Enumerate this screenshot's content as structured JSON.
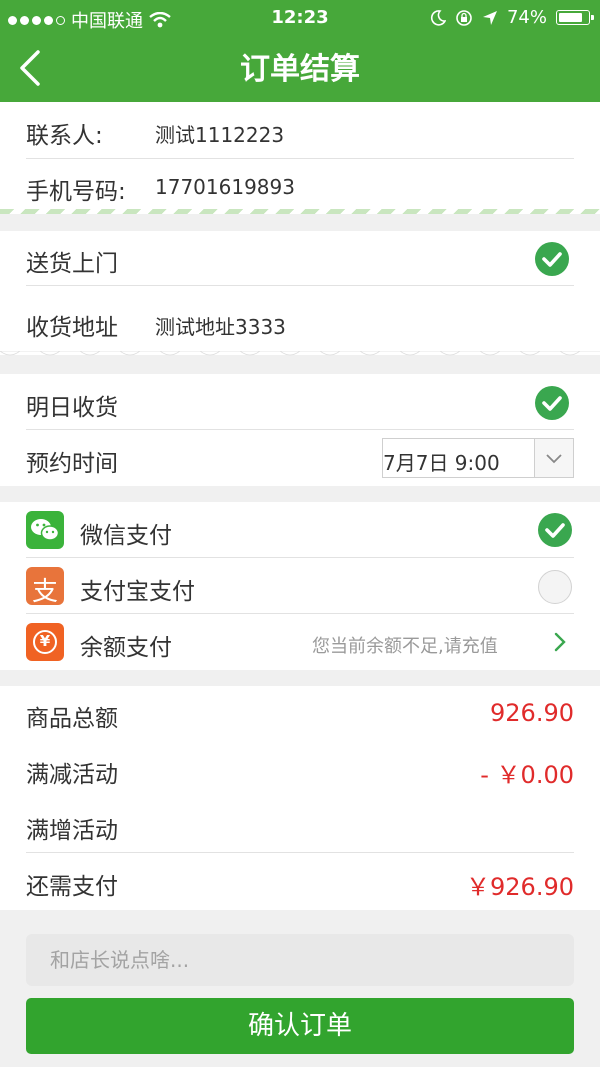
{
  "status_bar": {
    "carrier": "中国联通",
    "time": "12:23",
    "battery": "74%"
  },
  "nav": {
    "title": "订单结算"
  },
  "contact": {
    "name_label": "联系人:",
    "name_value": "测试1112223",
    "phone_label": "手机号码:",
    "phone_value": "17701619893"
  },
  "delivery": {
    "door_label": "送货上门",
    "address_label": "收货地址",
    "address_value": "测试地址3333"
  },
  "schedule": {
    "tomorrow_label": "明日收货",
    "time_label": "预约时间",
    "time_value": "7月7日 9:00"
  },
  "payment": {
    "wechat_label": "微信支付",
    "alipay_label": "支付宝支付",
    "alipay_glyph": "支",
    "balance_label": "余额支付",
    "balance_glyph": "¥",
    "balance_hint": "您当前余额不足,请充值"
  },
  "summary": {
    "total_label": "商品总额",
    "total_value": "926.90",
    "discount_label": "满减活动",
    "discount_value": "- ￥0.00",
    "gift_label": "满增活动",
    "due_label": "还需支付",
    "due_value": "￥926.90"
  },
  "note": {
    "placeholder": "和店长说点啥..."
  },
  "confirm": {
    "label": "确认订单"
  },
  "colors": {
    "brand": "#47a83a",
    "accent": "#3aa74f",
    "price": "#e02b2b",
    "button": "#32a42e"
  }
}
